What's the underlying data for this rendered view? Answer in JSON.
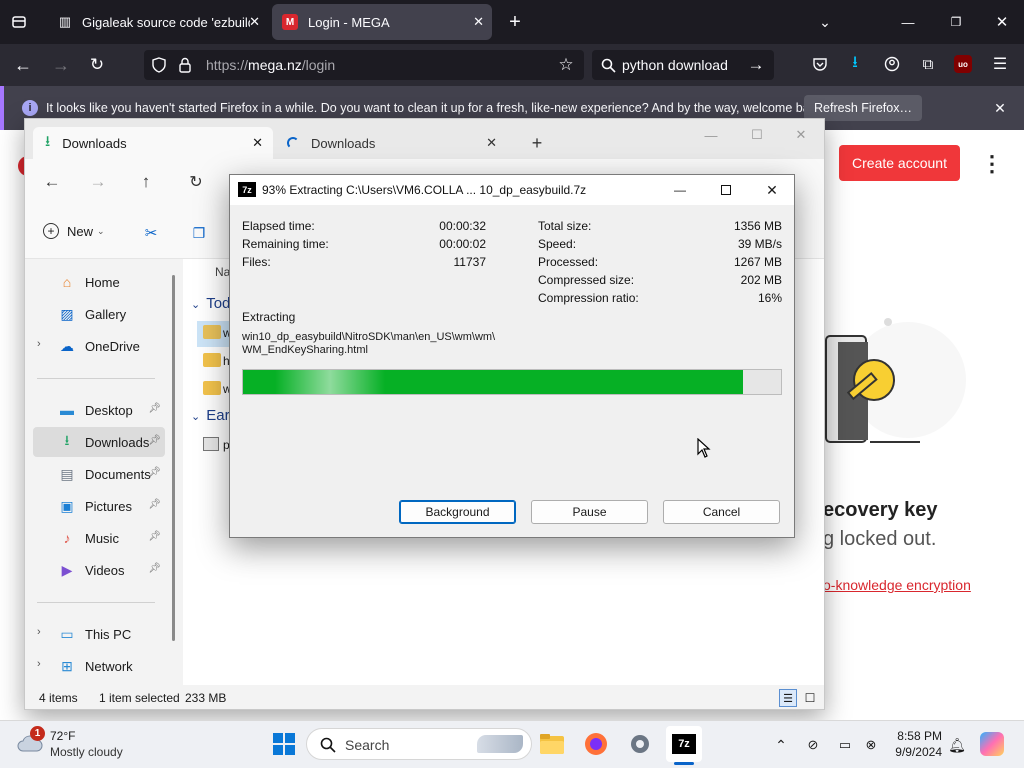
{
  "firefox": {
    "tabs": [
      {
        "title": "Gigaleak source code 'ezbuild' ·",
        "active": false
      },
      {
        "title": "Login - MEGA",
        "active": true
      }
    ],
    "url_prefix": "https://",
    "url_domain": "mega.nz",
    "url_path": "/login",
    "search_text": "python download",
    "notice_text": "It looks like you haven't started Firefox in a while. Do you want to clean it up for a fresh, like-new experience? And by the way, welcome back!",
    "notice_button": "Refresh Firefox…"
  },
  "mega": {
    "create_account": "Create account",
    "heading_partial": "ecovery key",
    "subtext_partial": "g locked out.",
    "link_partial": "o-knowledge encryption",
    "brand_color": "#f0373a"
  },
  "explorer": {
    "tabs": [
      {
        "title": "Downloads",
        "active": true
      },
      {
        "title": "Downloads",
        "active": false
      }
    ],
    "new_label": "New",
    "column_name": "Na",
    "groups": [
      "Tod",
      "Earl"
    ],
    "nav": [
      {
        "label": "Home",
        "icon": "home-icon",
        "expand": false,
        "pinned": false
      },
      {
        "label": "Gallery",
        "icon": "gallery-icon",
        "expand": false,
        "pinned": false
      },
      {
        "label": "OneDrive",
        "icon": "cloud-icon",
        "expand": true,
        "pinned": false
      },
      {
        "label": "Desktop",
        "icon": "desktop-icon",
        "expand": false,
        "pinned": true
      },
      {
        "label": "Downloads",
        "icon": "download-icon",
        "expand": false,
        "pinned": true,
        "selected": true
      },
      {
        "label": "Documents",
        "icon": "documents-icon",
        "expand": false,
        "pinned": true
      },
      {
        "label": "Pictures",
        "icon": "pictures-icon",
        "expand": false,
        "pinned": true
      },
      {
        "label": "Music",
        "icon": "music-icon",
        "expand": false,
        "pinned": true
      },
      {
        "label": "Videos",
        "icon": "videos-icon",
        "expand": false,
        "pinned": true
      },
      {
        "label": "This PC",
        "icon": "pc-icon",
        "expand": true,
        "pinned": false
      },
      {
        "label": "Network",
        "icon": "network-icon",
        "expand": true,
        "pinned": false
      }
    ],
    "files_partial": [
      "w",
      "h",
      "w",
      "p"
    ],
    "status_count": "4 items",
    "status_selected": "1 item selected",
    "status_size": "233 MB"
  },
  "sevenzip": {
    "title": "93% Extracting C:\\Users\\VM6.COLLA ... 10_dp_easybuild.7z",
    "progress": 0.93,
    "left_stats": [
      {
        "label": "Elapsed time:",
        "value": "00:00:32"
      },
      {
        "label": "Remaining time:",
        "value": "00:00:02"
      },
      {
        "label": "Files:",
        "value": "11737"
      }
    ],
    "right_stats": [
      {
        "label": "Total size:",
        "value": "1356 MB"
      },
      {
        "label": "Speed:",
        "value": "39 MB/s"
      },
      {
        "label": "Processed:",
        "value": "1267 MB"
      },
      {
        "label": "Compressed size:",
        "value": "202 MB"
      },
      {
        "label": "Compression ratio:",
        "value": "16%"
      }
    ],
    "action": "Extracting",
    "path_line1": "win10_dp_easybuild\\NitroSDK\\man\\en_US\\wm\\wm\\",
    "path_line2": "WM_EndKeySharing.html",
    "buttons": {
      "background": "Background",
      "pause": "Pause",
      "cancel": "Cancel"
    },
    "progress_color": "#06b025"
  },
  "taskbar": {
    "weather_temp": "72°F",
    "weather_desc": "Mostly cloudy",
    "weather_badge": "1",
    "search_label": "Search",
    "time": "8:58 PM",
    "date": "9/9/2024"
  }
}
